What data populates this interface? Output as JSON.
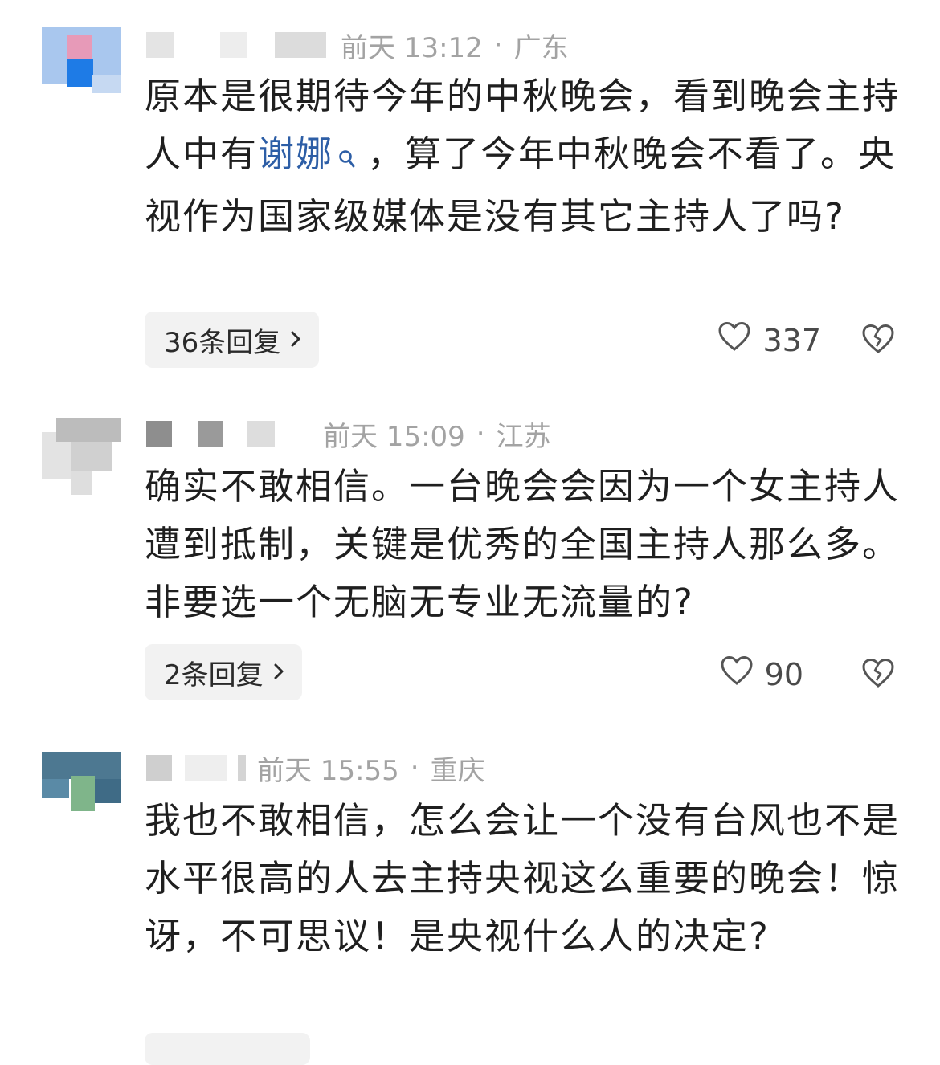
{
  "comments": [
    {
      "time": "前天 13:12",
      "separator": "·",
      "location": "广东",
      "text_before": "原本是很期待今年的中秋晚会，看到晚会主持人中有",
      "mention": "谢娜",
      "text_after": "，算了今年中秋晚会不看了。央视作为国家级媒体是没有其它主持人了吗?",
      "reply_label": "36条回复",
      "likes": "337"
    },
    {
      "time": "前天 15:09",
      "separator": "·",
      "location": "江苏",
      "text": "确实不敢相信。一台晚会会因为一个女主持人遭到抵制，关键是优秀的全国主持人那么多。非要选一个无脑无专业无流量的?",
      "reply_label": "2条回复",
      "likes": "90"
    },
    {
      "time": "前天 15:55",
      "separator": "·",
      "location": "重庆",
      "text": "我也不敢相信，怎么会让一个没有台风也不是水平很高的人去主持央视这么重要的晚会！惊讶，不可思议！是央视什么人的决定?"
    }
  ],
  "icons": {
    "like": "heart-outline-icon",
    "dislike": "broken-heart-icon",
    "reply_arrow": "chevron-right-icon",
    "mention_search": "search-icon"
  },
  "colors": {
    "mention": "#2d5ea6",
    "meta": "#a3a3a3",
    "reply_bg": "#f2f2f2"
  }
}
